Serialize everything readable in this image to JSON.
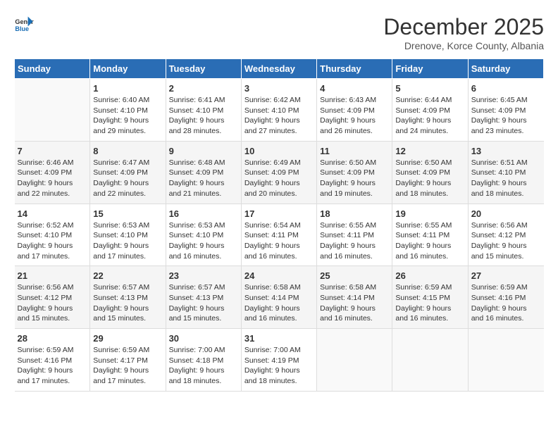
{
  "header": {
    "logo_line1": "General",
    "logo_line2": "Blue",
    "month": "December 2025",
    "location": "Drenove, Korce County, Albania"
  },
  "weekdays": [
    "Sunday",
    "Monday",
    "Tuesday",
    "Wednesday",
    "Thursday",
    "Friday",
    "Saturday"
  ],
  "weeks": [
    [
      {
        "day": "",
        "info": ""
      },
      {
        "day": "1",
        "info": "Sunrise: 6:40 AM\nSunset: 4:10 PM\nDaylight: 9 hours\nand 29 minutes."
      },
      {
        "day": "2",
        "info": "Sunrise: 6:41 AM\nSunset: 4:10 PM\nDaylight: 9 hours\nand 28 minutes."
      },
      {
        "day": "3",
        "info": "Sunrise: 6:42 AM\nSunset: 4:10 PM\nDaylight: 9 hours\nand 27 minutes."
      },
      {
        "day": "4",
        "info": "Sunrise: 6:43 AM\nSunset: 4:09 PM\nDaylight: 9 hours\nand 26 minutes."
      },
      {
        "day": "5",
        "info": "Sunrise: 6:44 AM\nSunset: 4:09 PM\nDaylight: 9 hours\nand 24 minutes."
      },
      {
        "day": "6",
        "info": "Sunrise: 6:45 AM\nSunset: 4:09 PM\nDaylight: 9 hours\nand 23 minutes."
      }
    ],
    [
      {
        "day": "7",
        "info": "Sunrise: 6:46 AM\nSunset: 4:09 PM\nDaylight: 9 hours\nand 22 minutes."
      },
      {
        "day": "8",
        "info": "Sunrise: 6:47 AM\nSunset: 4:09 PM\nDaylight: 9 hours\nand 22 minutes."
      },
      {
        "day": "9",
        "info": "Sunrise: 6:48 AM\nSunset: 4:09 PM\nDaylight: 9 hours\nand 21 minutes."
      },
      {
        "day": "10",
        "info": "Sunrise: 6:49 AM\nSunset: 4:09 PM\nDaylight: 9 hours\nand 20 minutes."
      },
      {
        "day": "11",
        "info": "Sunrise: 6:50 AM\nSunset: 4:09 PM\nDaylight: 9 hours\nand 19 minutes."
      },
      {
        "day": "12",
        "info": "Sunrise: 6:50 AM\nSunset: 4:09 PM\nDaylight: 9 hours\nand 18 minutes."
      },
      {
        "day": "13",
        "info": "Sunrise: 6:51 AM\nSunset: 4:10 PM\nDaylight: 9 hours\nand 18 minutes."
      }
    ],
    [
      {
        "day": "14",
        "info": "Sunrise: 6:52 AM\nSunset: 4:10 PM\nDaylight: 9 hours\nand 17 minutes."
      },
      {
        "day": "15",
        "info": "Sunrise: 6:53 AM\nSunset: 4:10 PM\nDaylight: 9 hours\nand 17 minutes."
      },
      {
        "day": "16",
        "info": "Sunrise: 6:53 AM\nSunset: 4:10 PM\nDaylight: 9 hours\nand 16 minutes."
      },
      {
        "day": "17",
        "info": "Sunrise: 6:54 AM\nSunset: 4:11 PM\nDaylight: 9 hours\nand 16 minutes."
      },
      {
        "day": "18",
        "info": "Sunrise: 6:55 AM\nSunset: 4:11 PM\nDaylight: 9 hours\nand 16 minutes."
      },
      {
        "day": "19",
        "info": "Sunrise: 6:55 AM\nSunset: 4:11 PM\nDaylight: 9 hours\nand 16 minutes."
      },
      {
        "day": "20",
        "info": "Sunrise: 6:56 AM\nSunset: 4:12 PM\nDaylight: 9 hours\nand 15 minutes."
      }
    ],
    [
      {
        "day": "21",
        "info": "Sunrise: 6:56 AM\nSunset: 4:12 PM\nDaylight: 9 hours\nand 15 minutes."
      },
      {
        "day": "22",
        "info": "Sunrise: 6:57 AM\nSunset: 4:13 PM\nDaylight: 9 hours\nand 15 minutes."
      },
      {
        "day": "23",
        "info": "Sunrise: 6:57 AM\nSunset: 4:13 PM\nDaylight: 9 hours\nand 15 minutes."
      },
      {
        "day": "24",
        "info": "Sunrise: 6:58 AM\nSunset: 4:14 PM\nDaylight: 9 hours\nand 16 minutes."
      },
      {
        "day": "25",
        "info": "Sunrise: 6:58 AM\nSunset: 4:14 PM\nDaylight: 9 hours\nand 16 minutes."
      },
      {
        "day": "26",
        "info": "Sunrise: 6:59 AM\nSunset: 4:15 PM\nDaylight: 9 hours\nand 16 minutes."
      },
      {
        "day": "27",
        "info": "Sunrise: 6:59 AM\nSunset: 4:16 PM\nDaylight: 9 hours\nand 16 minutes."
      }
    ],
    [
      {
        "day": "28",
        "info": "Sunrise: 6:59 AM\nSunset: 4:16 PM\nDaylight: 9 hours\nand 17 minutes."
      },
      {
        "day": "29",
        "info": "Sunrise: 6:59 AM\nSunset: 4:17 PM\nDaylight: 9 hours\nand 17 minutes."
      },
      {
        "day": "30",
        "info": "Sunrise: 7:00 AM\nSunset: 4:18 PM\nDaylight: 9 hours\nand 18 minutes."
      },
      {
        "day": "31",
        "info": "Sunrise: 7:00 AM\nSunset: 4:19 PM\nDaylight: 9 hours\nand 18 minutes."
      },
      {
        "day": "",
        "info": ""
      },
      {
        "day": "",
        "info": ""
      },
      {
        "day": "",
        "info": ""
      }
    ]
  ]
}
